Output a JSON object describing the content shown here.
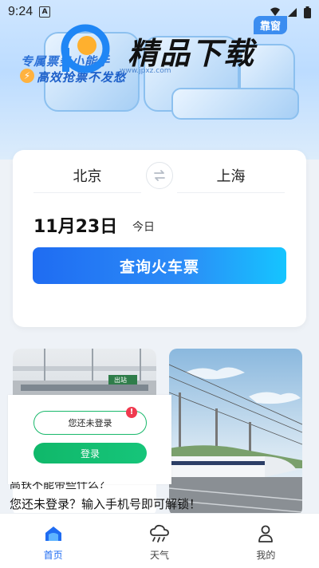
{
  "status_bar": {
    "time": "9:24",
    "notification_badge": "A"
  },
  "hero": {
    "slogan_line1": "专属票务小能手",
    "slogan_line2": "高效抢票不发愁",
    "watermark_text": "精品下载",
    "watermark_url": "www.jpxz.com",
    "window_tag": "靠窗"
  },
  "search": {
    "from_city": "北京",
    "to_city": "上海",
    "date": "11月23日",
    "day_label": "今日",
    "query_button": "查询火车票"
  },
  "feed": {
    "left_card": {
      "station_sign": "出站"
    }
  },
  "login_popup": {
    "status_text": "您还未登录",
    "alert_badge": "!",
    "login_button": "登录"
  },
  "article": {
    "title_partial": "高铁不能带些什么？",
    "description": "您还未登录？输入手机号即可解锁！"
  },
  "tabs": [
    {
      "label": "首页",
      "icon": "home-icon",
      "active": true
    },
    {
      "label": "天气",
      "icon": "weather-icon",
      "active": false
    },
    {
      "label": "我的",
      "icon": "profile-icon",
      "active": false
    }
  ],
  "colors": {
    "accent": "#1f6cf2",
    "login_green": "#10b86a",
    "alert_red": "#f03a4f"
  }
}
